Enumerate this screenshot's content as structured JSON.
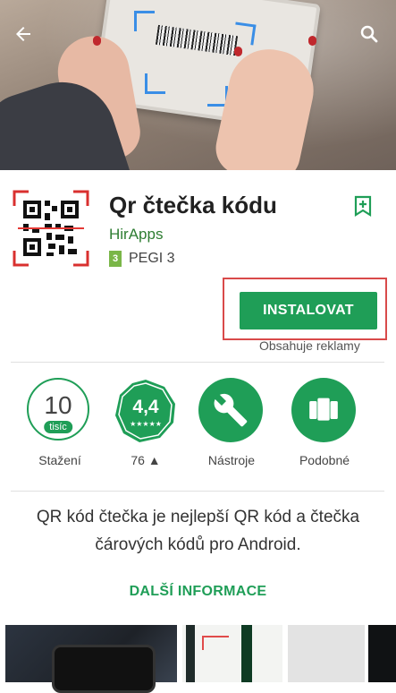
{
  "app": {
    "title": "Qr čtečka kódu",
    "developer": "HirApps",
    "rating_label": "PEGI 3",
    "pegi_number": "3"
  },
  "actions": {
    "install_label": "INSTALOVAT",
    "ads_note": "Obsahuje reklamy"
  },
  "stats": [
    {
      "value": "10",
      "unit": "tisíc",
      "label": "Stažení"
    },
    {
      "value": "4,4",
      "stars": "★★★★★",
      "label": "76 ▲"
    },
    {
      "icon": "wrench-icon",
      "label": "Nástroje"
    },
    {
      "icon": "cards-icon",
      "label": "Podobné"
    }
  ],
  "description": {
    "text": "QR kód čtečka je nejlepší QR kód a čtečka čárových kódů pro Android.",
    "more_label": "DALŠÍ INFORMACE"
  },
  "colors": {
    "accent": "#1f9e57",
    "highlight": "#d94a4a"
  }
}
